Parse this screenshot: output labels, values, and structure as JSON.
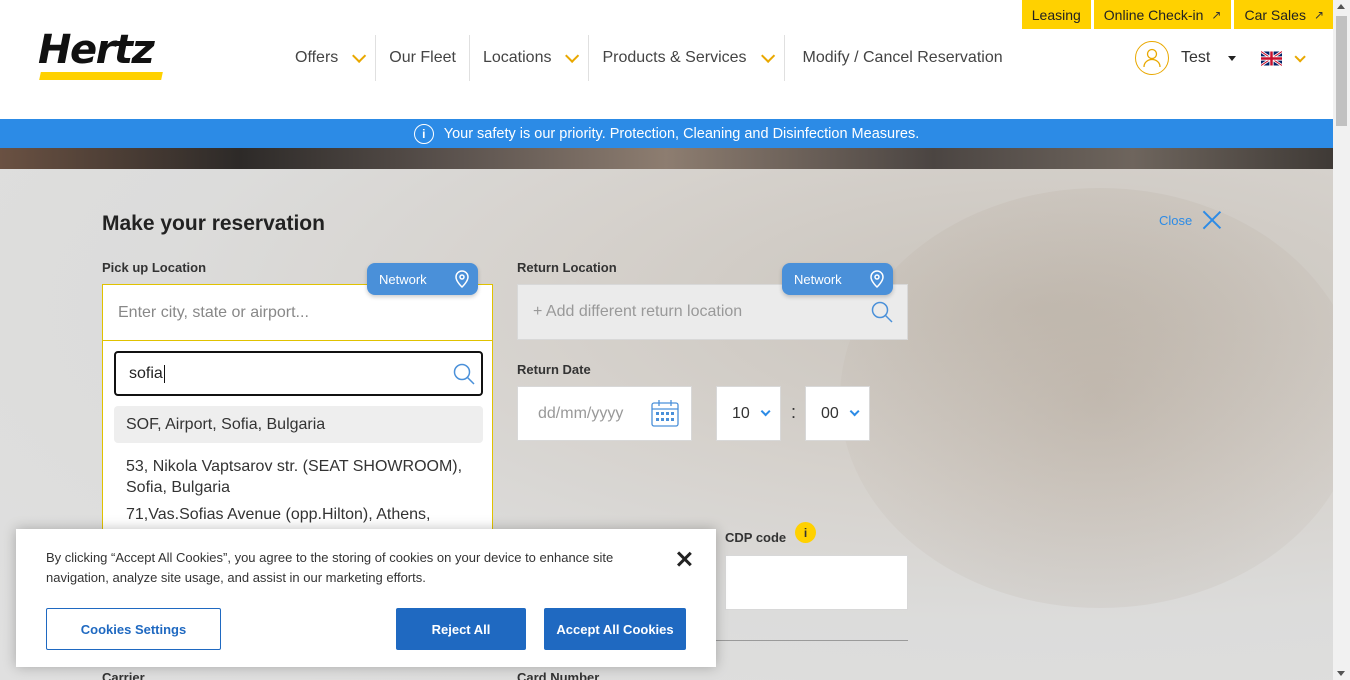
{
  "utility_links": [
    {
      "label": "Leasing",
      "external": false
    },
    {
      "label": "Online Check-in",
      "external": true
    },
    {
      "label": "Car Sales",
      "external": true
    }
  ],
  "brand": {
    "name": "Hertz",
    "accent_color": "#ffd100",
    "link_color": "#2c8be6"
  },
  "nav": {
    "items": [
      {
        "label": "Offers",
        "dropdown": true
      },
      {
        "label": "Our Fleet",
        "dropdown": false
      },
      {
        "label": "Locations",
        "dropdown": true
      },
      {
        "label": "Products & Services",
        "dropdown": true
      },
      {
        "label": "Modify / Cancel Reservation",
        "dropdown": false
      }
    ]
  },
  "user": {
    "name": "Test",
    "icon": "user-icon"
  },
  "language": {
    "flag": "uk-flag-icon"
  },
  "banner": {
    "text": "Your safety is our priority. Protection, Cleaning and Disinfection Measures.",
    "icon": "info-icon"
  },
  "reservation": {
    "title": "Make your reservation",
    "close_label": "Close",
    "pickup": {
      "label": "Pick up Location",
      "network_label": "Network",
      "placeholder": "Enter city, state or airport...",
      "search_value": "sofia",
      "suggestions": [
        "SOF, Airport, Sofia, Bulgaria",
        "53, Nikola Vaptsarov str. (SEAT SHOWROOM), Sofia, Bulgaria",
        "71,Vas.Sofias Avenue (opp.Hilton), Athens,"
      ]
    },
    "return": {
      "label": "Return Location",
      "network_label": "Network",
      "placeholder": "+ Add different return location"
    },
    "return_date": {
      "label": "Return Date",
      "placeholder": "dd/mm/yyyy",
      "hour": "10",
      "minute": "00",
      "separator": ":"
    },
    "cdp": {
      "label": "CDP code",
      "info": "i"
    },
    "carrier_label": "Carrier",
    "card_number_label": "Card Number"
  },
  "cookie": {
    "text": "By clicking “Accept All Cookies”, you agree to the storing of cookies on your device to enhance site navigation, analyze site usage, and assist in our marketing efforts.",
    "settings_label": "Cookies Settings",
    "reject_label": "Reject All",
    "accept_label": "Accept All Cookies"
  }
}
